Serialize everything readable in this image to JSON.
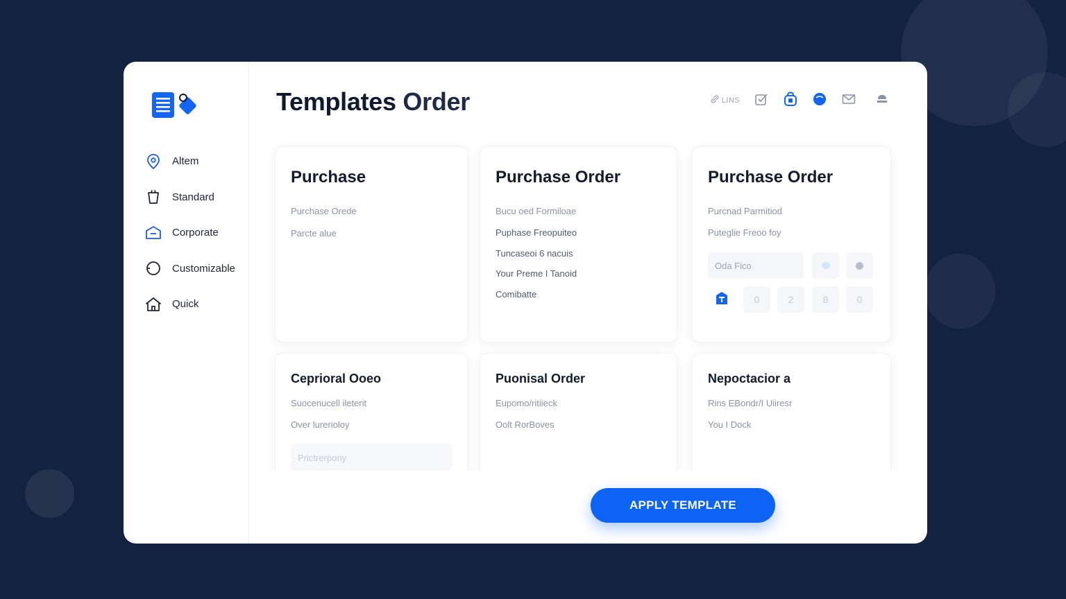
{
  "app": {
    "title": "Templates",
    "title_accent": "Order"
  },
  "colors": {
    "accent": "#0d63f3",
    "background": "#142241",
    "card": "#ffffff"
  },
  "sidebar": {
    "items": [
      {
        "label": "Altem",
        "icon": "location-pin-icon"
      },
      {
        "label": "Standard",
        "icon": "cup-icon"
      },
      {
        "label": "Corporate",
        "icon": "building-icon"
      },
      {
        "label": "Customizable",
        "icon": "circle-icon"
      },
      {
        "label": "Quick",
        "icon": "home-icon"
      }
    ]
  },
  "toolbar": {
    "link_label": "LINS",
    "icons": [
      "link-icon",
      "checkbox-icon",
      "bag-icon",
      "circle-fill-icon",
      "mail-icon",
      "user-icon"
    ]
  },
  "cards": [
    {
      "title": "Purchase",
      "lines": [
        "Purchase Orede",
        "Parcte alue"
      ]
    },
    {
      "title": "Purchase Order",
      "lines": [
        "Bucu oed Formiloae",
        "Puphase Freopuiteo",
        "Tuncaseoi 6 nacuis",
        "Your Preme I Tanoid",
        "Comibatte"
      ]
    },
    {
      "title": "Purchase Order",
      "lines": [
        "Purcnad Parmitiod",
        "Puteglie Freoo foy"
      ],
      "field_label": "Oda Fico",
      "digits": [
        "0",
        "2",
        "8",
        "0"
      ]
    },
    {
      "title": "Ceprioral Ooeo",
      "lines": [
        "Suocenucell ileterit",
        "Over lurerioloy"
      ],
      "field_label": "Prictrerpony"
    },
    {
      "title": "Puonisal Order",
      "lines": [
        "Eupomo/ritiieck",
        "Oolt RorBoves"
      ]
    },
    {
      "title": "Nepoctacior a",
      "lines": [
        "Rins EBondr/I Uiiresr",
        "You I Dock"
      ]
    }
  ],
  "actions": {
    "apply_label": "APPLY TEMPLATE"
  }
}
